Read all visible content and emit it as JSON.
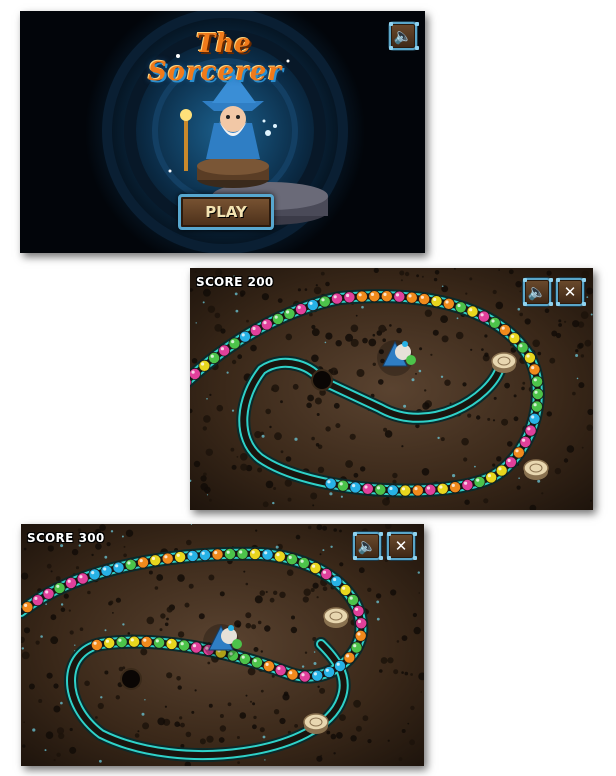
{
  "menu_screen": {
    "title_line1": "The",
    "title_line2": "Sorcerer",
    "play_label": "PLAY",
    "sound_icon": "speaker-icon"
  },
  "gameplay_screens": [
    {
      "score_label": "SCORE",
      "score_value": "200",
      "sound_icon": "speaker-icon",
      "close_icon": "close-icon"
    },
    {
      "score_label": "SCORE",
      "score_value": "300",
      "sound_icon": "speaker-icon",
      "close_icon": "close-icon"
    }
  ],
  "marble_colors": [
    "#e8d61e",
    "#27b2e6",
    "#e0409b",
    "#4cc34a",
    "#f08a1c"
  ],
  "track_color": "#2fd1c8"
}
